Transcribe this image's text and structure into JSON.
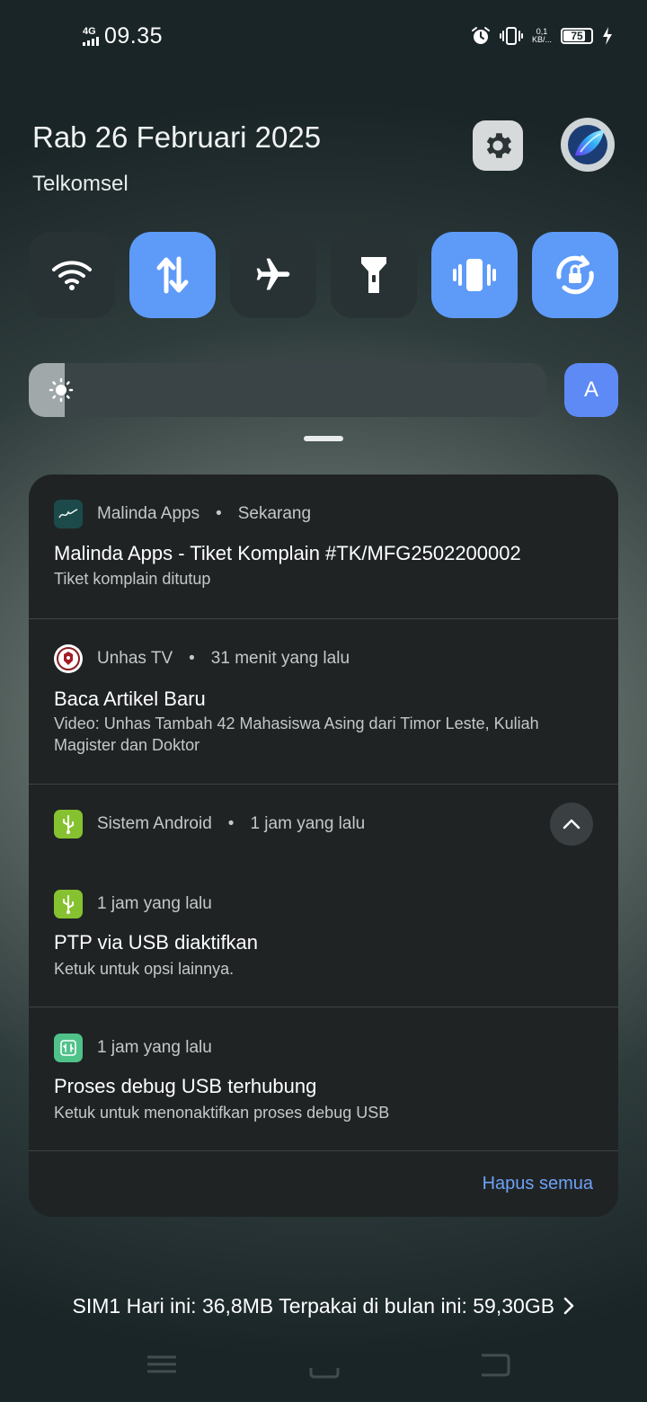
{
  "status_bar": {
    "network": "4G",
    "time": "09.35",
    "speed_value": "0,1",
    "speed_unit": "KB/...",
    "battery": "75"
  },
  "header": {
    "date": "Rab 26 Februari 2025",
    "carrier": "Telkomsel"
  },
  "quick_tiles": [
    {
      "icon": "wifi-icon",
      "state": "off"
    },
    {
      "icon": "mobile-data-icon",
      "state": "on"
    },
    {
      "icon": "airplane-icon",
      "state": "off"
    },
    {
      "icon": "flashlight-icon",
      "state": "off"
    },
    {
      "icon": "vibrate-icon",
      "state": "on"
    },
    {
      "icon": "auto-rotate-icon",
      "state": "on"
    }
  ],
  "brightness": {
    "level": 0.07,
    "auto_label": "A"
  },
  "notifications": [
    {
      "app": "Malinda Apps",
      "time": "Sekarang",
      "title": "Malinda Apps - Tiket Komplain #TK/MFG2502200002",
      "body": "Tiket komplain ditutup"
    },
    {
      "app": "Unhas TV",
      "time": "31 menit yang lalu",
      "title": "Baca Artikel Baru",
      "body": "Video: Unhas Tambah 42 Mahasiswa Asing dari Timor Leste, Kuliah Magister dan Doktor"
    },
    {
      "app": "Sistem Android",
      "time": "1 jam yang lalu",
      "children": [
        {
          "time": "1 jam yang lalu",
          "title": "PTP via USB diaktifkan",
          "body": "Ketuk untuk opsi lainnya."
        },
        {
          "time": "1 jam yang lalu",
          "title": "Proses debug USB terhubung",
          "body": "Ketuk untuk menonaktifkan proses debug USB"
        }
      ]
    }
  ],
  "clear_all_label": "Hapus semua",
  "data_usage": "SIM1 Hari ini: 36,8MB Terpakai di bulan ini: 59,30GB",
  "colors": {
    "tile_on": "#5e9bf8",
    "tile_off": "#283234",
    "link": "#6ea1f5",
    "panel": "#1f2324"
  }
}
